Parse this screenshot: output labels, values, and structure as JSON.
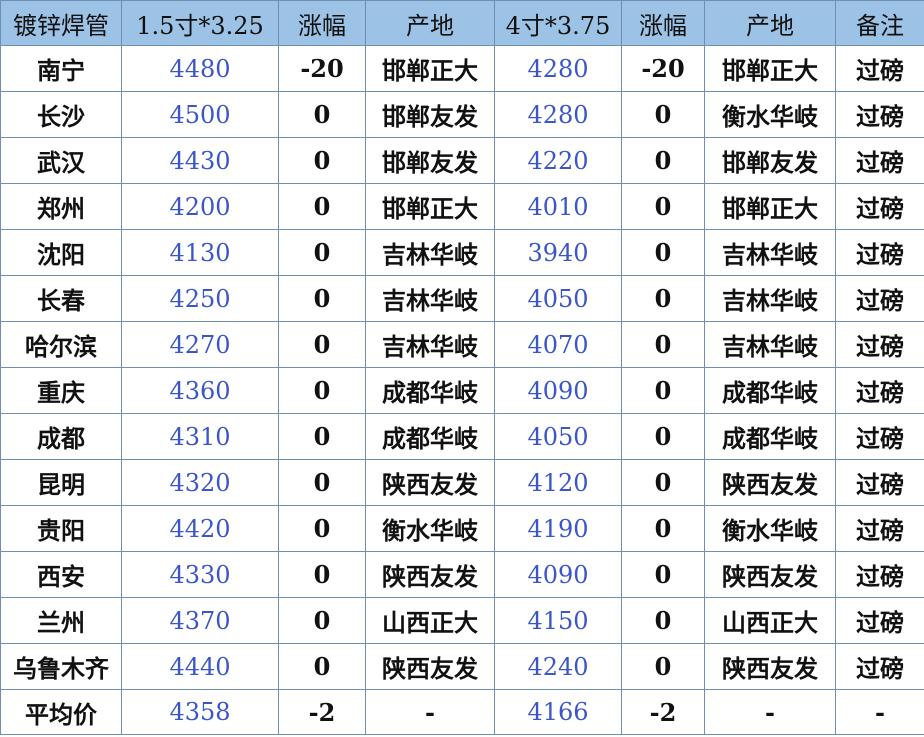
{
  "headers": [
    "镀锌焊管",
    "1.5寸*3.25",
    "涨幅",
    "产地",
    "4寸*3.75",
    "涨幅",
    "产地",
    "备注"
  ],
  "rows": [
    [
      "南宁",
      "4480",
      "-20",
      "邯郸正大",
      "4280",
      "-20",
      "邯郸正大",
      "过磅"
    ],
    [
      "长沙",
      "4500",
      "0",
      "邯郸友发",
      "4280",
      "0",
      "衡水华岐",
      "过磅"
    ],
    [
      "武汉",
      "4430",
      "0",
      "邯郸友发",
      "4220",
      "0",
      "邯郸友发",
      "过磅"
    ],
    [
      "郑州",
      "4200",
      "0",
      "邯郸正大",
      "4010",
      "0",
      "邯郸正大",
      "过磅"
    ],
    [
      "沈阳",
      "4130",
      "0",
      "吉林华岐",
      "3940",
      "0",
      "吉林华岐",
      "过磅"
    ],
    [
      "长春",
      "4250",
      "0",
      "吉林华岐",
      "4050",
      "0",
      "吉林华岐",
      "过磅"
    ],
    [
      "哈尔滨",
      "4270",
      "0",
      "吉林华岐",
      "4070",
      "0",
      "吉林华岐",
      "过磅"
    ],
    [
      "重庆",
      "4360",
      "0",
      "成都华岐",
      "4090",
      "0",
      "成都华岐",
      "过磅"
    ],
    [
      "成都",
      "4310",
      "0",
      "成都华岐",
      "4050",
      "0",
      "成都华岐",
      "过磅"
    ],
    [
      "昆明",
      "4320",
      "0",
      "陕西友发",
      "4120",
      "0",
      "陕西友发",
      "过磅"
    ],
    [
      "贵阳",
      "4420",
      "0",
      "衡水华岐",
      "4190",
      "0",
      "衡水华岐",
      "过磅"
    ],
    [
      "西安",
      "4330",
      "0",
      "陕西友发",
      "4090",
      "0",
      "陕西友发",
      "过磅"
    ],
    [
      "兰州",
      "4370",
      "0",
      "山西正大",
      "4150",
      "0",
      "山西正大",
      "过磅"
    ],
    [
      "乌鲁木齐",
      "4440",
      "0",
      "陕西友发",
      "4240",
      "0",
      "陕西友发",
      "过磅"
    ],
    [
      "平均价",
      "4358",
      "-2",
      "-",
      "4166",
      "-2",
      "-",
      "-"
    ]
  ]
}
